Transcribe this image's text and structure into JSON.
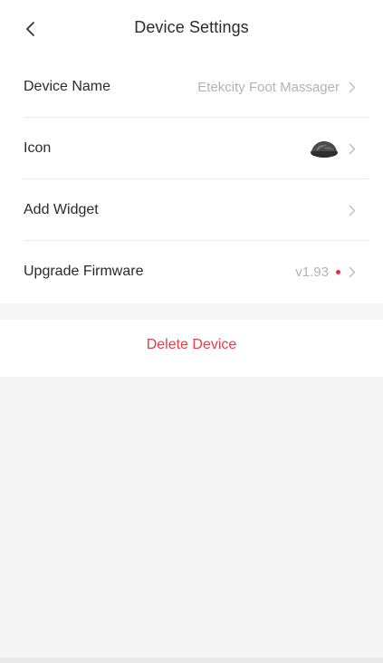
{
  "header": {
    "title": "Device Settings",
    "back_icon": "chevron-left-icon"
  },
  "settings": {
    "device_name": {
      "label": "Device Name",
      "value": "Etekcity Foot Massager"
    },
    "icon": {
      "label": "Icon",
      "device_icon": "foot-massager-icon"
    },
    "add_widget": {
      "label": "Add Widget"
    },
    "upgrade_firmware": {
      "label": "Upgrade Firmware",
      "version": "v1.93",
      "update_indicator_color": "#e0323a"
    }
  },
  "actions": {
    "delete_label": "Delete Device",
    "delete_color": "#e0404a"
  }
}
